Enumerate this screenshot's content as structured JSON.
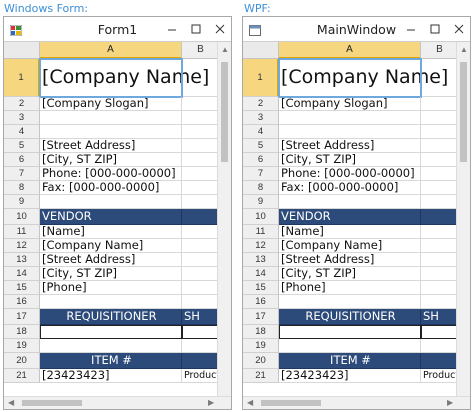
{
  "captions": {
    "left": "Windows Form:",
    "right": "WPF:"
  },
  "windows": [
    {
      "title": "Form1",
      "columns": [
        "A",
        "B"
      ],
      "rows": [
        {
          "num": "1",
          "text": "[Company Name]"
        },
        {
          "num": "2",
          "text": "[Company Slogan]"
        },
        {
          "num": "3",
          "text": ""
        },
        {
          "num": "4",
          "text": ""
        },
        {
          "num": "5",
          "text": "[Street Address]"
        },
        {
          "num": "6",
          "text": "[City, ST ZIP]"
        },
        {
          "num": "7",
          "text": "Phone: [000-000-0000]"
        },
        {
          "num": "8",
          "text": "Fax: [000-000-0000]"
        },
        {
          "num": "9",
          "text": ""
        },
        {
          "num": "10",
          "text": "VENDOR"
        },
        {
          "num": "11",
          "text": "[Name]"
        },
        {
          "num": "12",
          "text": "[Company Name]"
        },
        {
          "num": "13",
          "text": "[Street Address]"
        },
        {
          "num": "14",
          "text": "[City, ST ZIP]"
        },
        {
          "num": "15",
          "text": "[Phone]"
        },
        {
          "num": "16",
          "text": ""
        },
        {
          "num": "17",
          "text": "REQUISITIONER",
          "b": "SH"
        },
        {
          "num": "18",
          "text": ""
        },
        {
          "num": "19",
          "text": ""
        },
        {
          "num": "20",
          "text": "ITEM #"
        },
        {
          "num": "21",
          "text": "[23423423]",
          "b": "Product"
        }
      ]
    },
    {
      "title": "MainWindow",
      "columns": [
        "A",
        "B"
      ],
      "rows": [
        {
          "num": "1",
          "text": "[Company Name]"
        },
        {
          "num": "2",
          "text": "[Company Slogan]"
        },
        {
          "num": "3",
          "text": ""
        },
        {
          "num": "4",
          "text": ""
        },
        {
          "num": "5",
          "text": "[Street Address]"
        },
        {
          "num": "6",
          "text": "[City, ST ZIP]"
        },
        {
          "num": "7",
          "text": "Phone: [000-000-0000]"
        },
        {
          "num": "8",
          "text": "Fax: [000-000-0000]"
        },
        {
          "num": "9",
          "text": ""
        },
        {
          "num": "10",
          "text": "VENDOR"
        },
        {
          "num": "11",
          "text": "[Name]"
        },
        {
          "num": "12",
          "text": "[Company Name]"
        },
        {
          "num": "13",
          "text": "[Street Address]"
        },
        {
          "num": "14",
          "text": "[City, ST ZIP]"
        },
        {
          "num": "15",
          "text": "[Phone]"
        },
        {
          "num": "16",
          "text": ""
        },
        {
          "num": "17",
          "text": "REQUISITIONER",
          "b": "SH"
        },
        {
          "num": "18",
          "text": ""
        },
        {
          "num": "19",
          "text": ""
        },
        {
          "num": "20",
          "text": "ITEM #"
        },
        {
          "num": "21",
          "text": "[23423423]",
          "b": "Product"
        }
      ]
    }
  ],
  "colors": {
    "band": "#2c4b7a",
    "selected_header": "#f7d680",
    "caption": "#3c8fd6"
  },
  "icons": {
    "form1_app": "winforms-app-icon",
    "wpf_app": "wpf-window-icon"
  }
}
